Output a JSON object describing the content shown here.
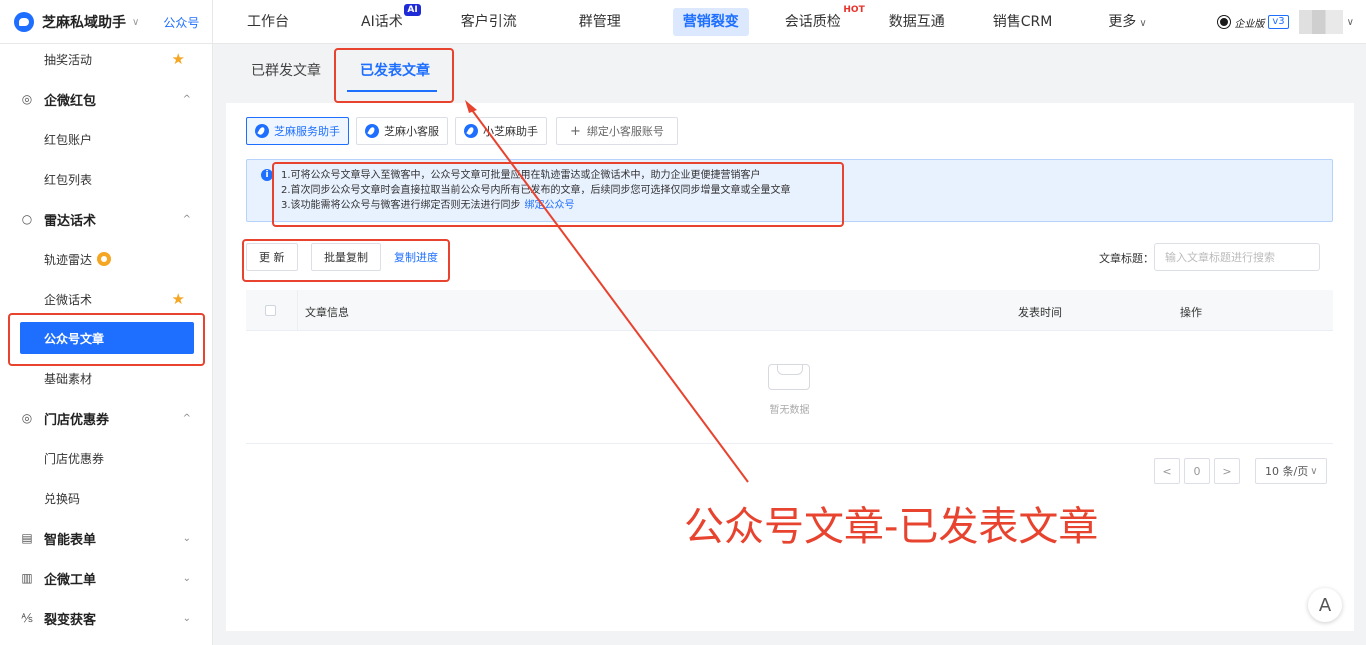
{
  "topbar": {
    "brand_name": "芝麻私域助手",
    "brand_caret": "∨",
    "brand_tag": "公众号",
    "nav": [
      {
        "label": "工作台",
        "badge": ""
      },
      {
        "label": "AI话术",
        "badge": "AI"
      },
      {
        "label": "客户引流",
        "badge": ""
      },
      {
        "label": "群管理",
        "badge": ""
      },
      {
        "label": "营销裂变",
        "badge": ""
      },
      {
        "label": "会话质检",
        "badge": "HOT"
      },
      {
        "label": "数据互通",
        "badge": ""
      },
      {
        "label": "销售CRM",
        "badge": ""
      },
      {
        "label": "更多",
        "badge": ""
      }
    ],
    "active_nav": "营销裂变",
    "enterprise_label": "企业版",
    "version": "v3",
    "user_caret": "∨"
  },
  "sidebar": {
    "items": [
      {
        "label": "抽奖活动",
        "type": "sub",
        "star": true
      },
      {
        "label": "企微红包",
        "type": "group",
        "icon": "red-packet-icon",
        "caret": "^"
      },
      {
        "label": "红包账户",
        "type": "sub"
      },
      {
        "label": "红包列表",
        "type": "sub"
      },
      {
        "label": "雷达话术",
        "type": "group",
        "icon": "radar-icon",
        "caret": "^"
      },
      {
        "label": "轨迹雷达",
        "type": "sub",
        "badge": true
      },
      {
        "label": "企微话术",
        "type": "sub",
        "star": true
      },
      {
        "label": "公众号文章",
        "type": "active"
      },
      {
        "label": "基础素材",
        "type": "sub"
      },
      {
        "label": "门店优惠券",
        "type": "group",
        "icon": "coupon-icon",
        "caret": "^"
      },
      {
        "label": "门店优惠券",
        "type": "sub"
      },
      {
        "label": "兑换码",
        "type": "sub"
      },
      {
        "label": "智能表单",
        "type": "group",
        "icon": "form-icon",
        "caret": "v"
      },
      {
        "label": "企微工单",
        "type": "group",
        "icon": "ticket-icon",
        "caret": "v"
      },
      {
        "label": "裂变获客",
        "type": "group",
        "icon": "fission-icon",
        "caret": "v"
      }
    ]
  },
  "tabs": {
    "items": [
      "已群发文章",
      "已发表文章"
    ],
    "active": "已发表文章"
  },
  "accounts": {
    "items": [
      "芝麻服务助手",
      "芝麻小客服",
      "小芝麻助手"
    ],
    "active": "芝麻服务助手",
    "add_label": "绑定小客服账号"
  },
  "notice": {
    "lines": [
      "1.可将公众号文章导入至微客中，公众号文章可批量应用在轨迹雷达或企微话术中，助力企业更便捷营销客户",
      "2.首次同步公众号文章时会直接拉取当前公众号内所有已发布的文章，后续同步您可选择仅同步增量文章或全量文章",
      "3.该功能需将公众号与微客进行绑定否则无法进行同步"
    ],
    "link": "绑定公众号"
  },
  "toolbar": {
    "refresh": "更 新",
    "batch_copy": "批量复制",
    "copy_progress": "复制进度",
    "search_label": "文章标题：",
    "search_placeholder": "输入文章标题进行搜索"
  },
  "table": {
    "columns": [
      "文章信息",
      "发表时间",
      "操作"
    ],
    "empty_text": "暂无数据"
  },
  "pagination": {
    "prev": "<",
    "page": "0",
    "next": ">",
    "page_size": "10 条/页"
  },
  "float_button": "A",
  "annotation": {
    "text": "公众号文章-已发表文章",
    "color": "#e8432f"
  },
  "colors": {
    "accent": "#1e6fff",
    "annotation": "#e8432f",
    "star": "#f5a623"
  }
}
